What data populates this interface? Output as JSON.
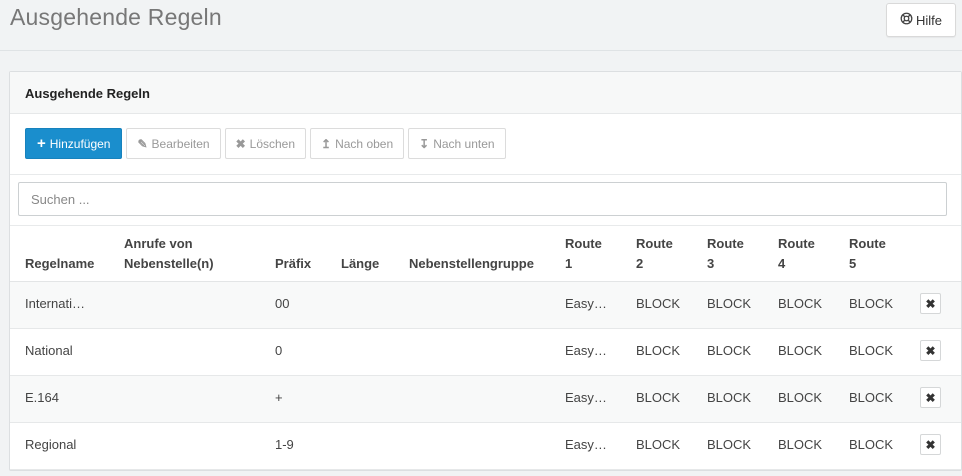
{
  "page": {
    "title": "Ausgehende Regeln"
  },
  "help": {
    "label": "Hilfe"
  },
  "panel": {
    "title": "Ausgehende Regeln"
  },
  "toolbar": {
    "add": "Hinzufügen",
    "edit": "Bearbeiten",
    "delete": "Löschen",
    "up": "Nach oben",
    "down": "Nach unten"
  },
  "search": {
    "placeholder": "Suchen ..."
  },
  "table": {
    "headers": {
      "name": "Regelname",
      "calls_line1": "Anrufe von",
      "calls_line2": "Nebenstelle(n)",
      "prefix": "Präfix",
      "length": "Länge",
      "group": "Nebenstellengruppe",
      "route": "Route",
      "r1": "1",
      "r2": "2",
      "r3": "3",
      "r4": "4",
      "r5": "5"
    },
    "rows": [
      {
        "name": "Internati…",
        "calls": "",
        "prefix": "00",
        "length": "",
        "group": "",
        "r1": "Easy…",
        "r2": "BLOCK",
        "r3": "BLOCK",
        "r4": "BLOCK",
        "r5": "BLOCK"
      },
      {
        "name": "National",
        "calls": "",
        "prefix": "0",
        "length": "",
        "group": "",
        "r1": "Easy…",
        "r2": "BLOCK",
        "r3": "BLOCK",
        "r4": "BLOCK",
        "r5": "BLOCK"
      },
      {
        "name": "E.164",
        "calls": "",
        "prefix": "+",
        "length": "",
        "group": "",
        "r1": "Easy…",
        "r2": "BLOCK",
        "r3": "BLOCK",
        "r4": "BLOCK",
        "r5": "BLOCK"
      },
      {
        "name": "Regional",
        "calls": "",
        "prefix": "1-9",
        "length": "",
        "group": "",
        "r1": "Easy…",
        "r2": "BLOCK",
        "r3": "BLOCK",
        "r4": "BLOCK",
        "r5": "BLOCK"
      }
    ]
  },
  "icons": {
    "help": "lifebuoy-icon",
    "add": "plus-icon",
    "edit": "pencil-icon",
    "delete": "times-icon",
    "up": "arrow-up-icon",
    "down": "arrow-down-icon",
    "row_delete": "times-icon"
  },
  "colors": {
    "primary": "#1a8ecd"
  }
}
